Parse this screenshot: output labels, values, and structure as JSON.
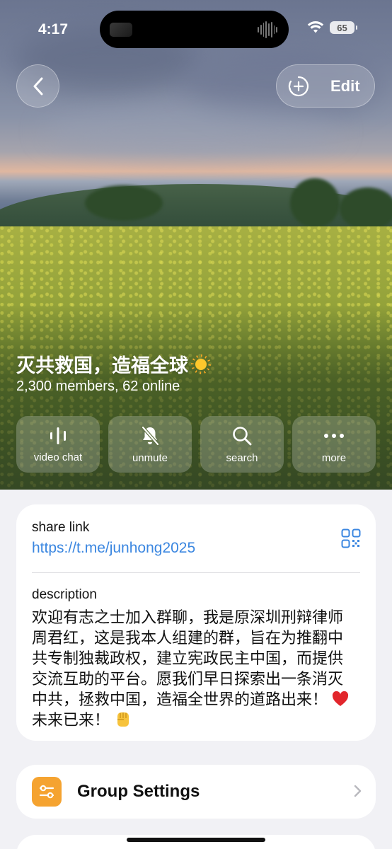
{
  "status_bar": {
    "time": "4:17",
    "battery": "65"
  },
  "header": {
    "edit_label": "Edit"
  },
  "group": {
    "title": "灭共救国，造福全球",
    "subtitle": "2,300 members, 62 online"
  },
  "actions": [
    {
      "label": "video chat",
      "icon": "waveform-icon"
    },
    {
      "label": "unmute",
      "icon": "bell-slash-icon"
    },
    {
      "label": "search",
      "icon": "search-icon"
    },
    {
      "label": "more",
      "icon": "ellipsis-icon"
    }
  ],
  "info": {
    "share_label": "share link",
    "share_url": "https://t.me/junhong2025",
    "description_label": "description",
    "description_main": "欢迎有志之士加入群聊，我是原深圳刑辩律师周君红，这是我本人组建的群，旨在为推翻中共专制独裁政权，建立宪政民主中国，而提供交流互助的平台。愿我们早日探索出一条消灭中共，拯救中国，造福全世界的道路出来！",
    "description_tail": "未来已来！"
  },
  "settings": {
    "label": "Group Settings"
  },
  "colors": {
    "link": "#3a86e0",
    "settings_icon_bg": "#f5a330",
    "page_bg": "#f1f1f5"
  }
}
